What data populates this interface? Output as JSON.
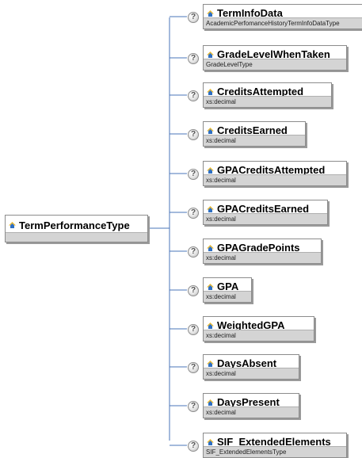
{
  "root": {
    "name": "TermPerformanceType",
    "icon": "complex-type-icon"
  },
  "help_symbol": "?",
  "elements": [
    {
      "name": "TermInfoData",
      "type": "AcademicPerfomanceHistoryTermInfoDataType"
    },
    {
      "name": "GradeLevelWhenTaken",
      "type": "GradeLevelType"
    },
    {
      "name": "CreditsAttempted",
      "type": "xs:decimal"
    },
    {
      "name": "CreditsEarned",
      "type": "xs:decimal"
    },
    {
      "name": "GPACreditsAttempted",
      "type": "xs:decimal"
    },
    {
      "name": "GPACreditsEarned",
      "type": "xs:decimal"
    },
    {
      "name": "GPAGradePoints",
      "type": "xs:decimal"
    },
    {
      "name": "GPA",
      "type": "xs:decimal"
    },
    {
      "name": "WeightedGPA",
      "type": "xs:decimal"
    },
    {
      "name": "DaysAbsent",
      "type": "xs:decimal"
    },
    {
      "name": "DaysPresent",
      "type": "xs:decimal"
    },
    {
      "name": "SIF_ExtendedElements",
      "type": "SIF_ExtendedElementsType"
    }
  ],
  "colors": {
    "line": "#4a74b8",
    "icon_blue": "#2e6fc2",
    "icon_yellow": "#e8b830",
    "type_band": "#d4d4d4"
  }
}
